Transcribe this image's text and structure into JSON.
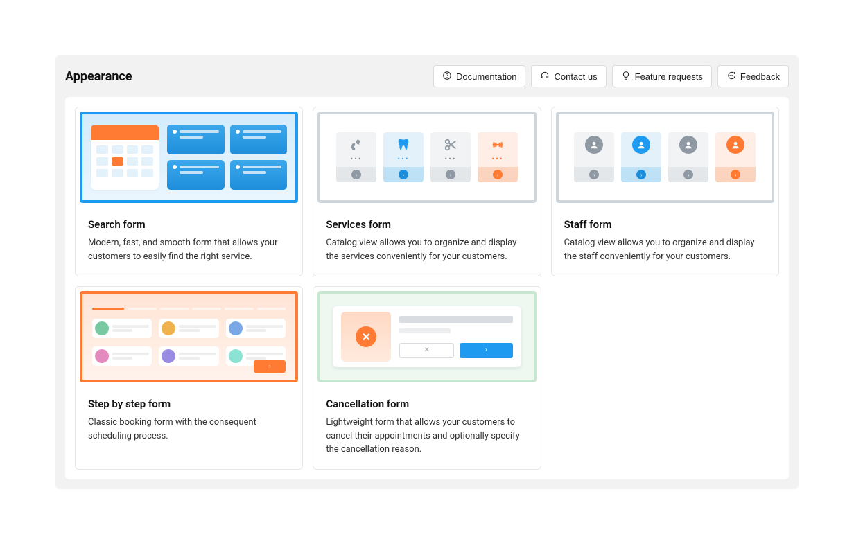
{
  "page": {
    "title": "Appearance"
  },
  "header_actions": {
    "documentation": "Documentation",
    "contact": "Contact us",
    "feature_requests": "Feature requests",
    "feedback": "Feedback"
  },
  "cards": {
    "search": {
      "title": "Search form",
      "desc": "Modern, fast, and smooth form that allows your customers to easily find the right service."
    },
    "services": {
      "title": "Services form",
      "desc": "Catalog view allows you to organize and display the services conveniently for your customers."
    },
    "staff": {
      "title": "Staff form",
      "desc": "Catalog view allows you to organize and display the staff conveniently for your customers."
    },
    "step": {
      "title": "Step by step form",
      "desc": "Classic booking form with the consequent scheduling process."
    },
    "cancel": {
      "title": "Cancellation form",
      "desc": "Lightweight form that allows your customers to cancel their appointments and optionally specify the cancellation reason."
    }
  }
}
